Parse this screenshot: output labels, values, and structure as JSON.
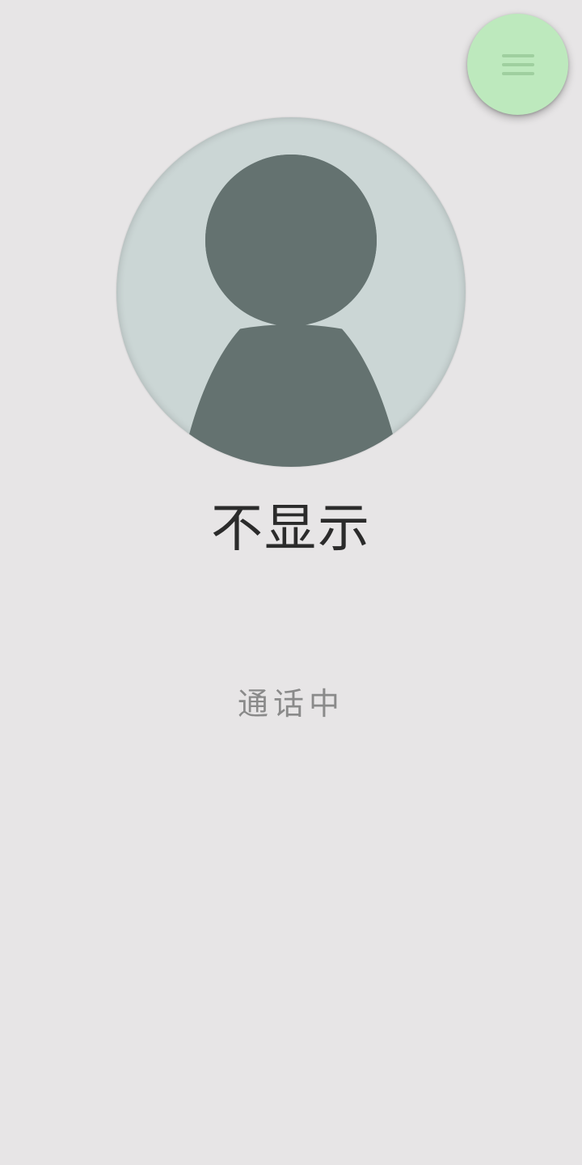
{
  "menu_button": {
    "icon": "menu-icon",
    "color": "#bde9bd"
  },
  "avatar": {
    "icon": "person-silhouette-icon",
    "background": "#cbd6d5",
    "figure_color": "#647270"
  },
  "caller": {
    "name": "不显示"
  },
  "call": {
    "status": "通话中"
  }
}
